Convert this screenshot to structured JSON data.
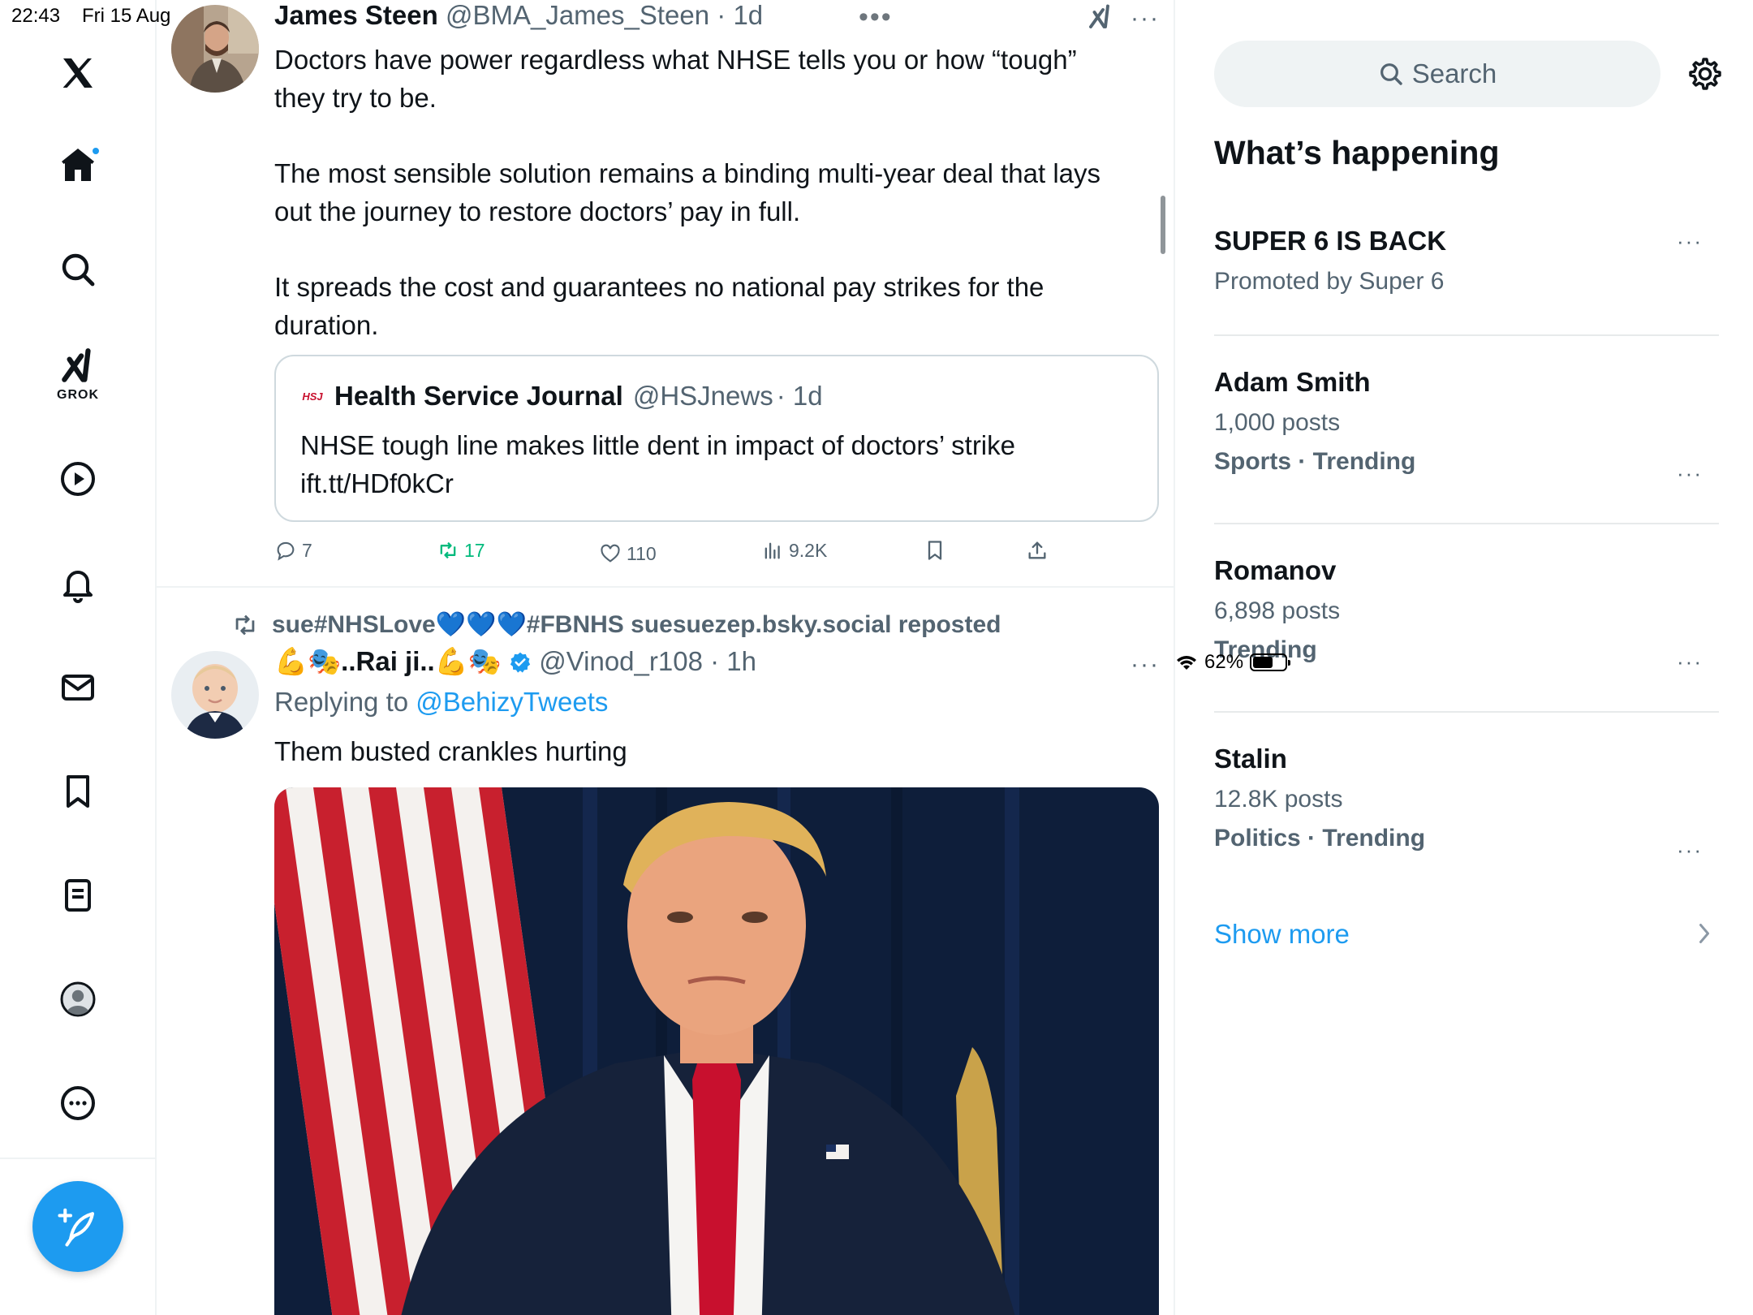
{
  "status": {
    "time": "22:43",
    "date": "Fri 15 Aug",
    "battery": "62%",
    "battery_level": 0.62
  },
  "nav": {
    "grok_label": "GROK",
    "items": [
      "home-icon",
      "search-icon",
      "grok-icon",
      "video-icon",
      "notifications-icon",
      "messages-icon",
      "bookmarks-icon",
      "lists-icon",
      "profile-icon",
      "more-icon"
    ],
    "compose_icon": "compose-icon"
  },
  "tweet1": {
    "name": "James Steen",
    "handle": "@BMA_James_Steen",
    "time": "· 1d",
    "para1": "Doctors have power regardless what NHSE tells you or how “tough” they try to be.",
    "para2": "The most sensible solution remains a binding multi-year deal that lays out the journey to restore doctors’ pay in full.",
    "para3": "It spreads the cost and guarantees no national pay strikes for the duration.",
    "quote": {
      "logo": "HSJ",
      "name": "Health Service Journal",
      "handle": "@HSJnews",
      "time": "· 1d",
      "text": "NHSE tough line makes little dent in impact of doctors’ strike ift.tt/HDf0kCr"
    },
    "actions": {
      "replies": "7",
      "reposts": "17",
      "likes": "110",
      "views": "9.2K"
    }
  },
  "tweet2": {
    "repost_by": "sue#NHSLove💙💙💙#FBNHS suesuezep.bsky.social reposted",
    "name": "💪🎭..Rai ji..💪🎭",
    "handle": "@Vinod_r108",
    "time": "· 1h",
    "replying_label": "Replying to",
    "replying_to": "@BehizyTweets",
    "text": "Them busted crankles hurting"
  },
  "sidebar": {
    "search_placeholder": "Search",
    "title": "What’s happening",
    "trends": [
      {
        "title": "SUPER 6 IS BACK",
        "line2": "Promoted by Super 6",
        "line3": ""
      },
      {
        "title": "Adam Smith",
        "line2": "1,000 posts",
        "line3": "Sports · Trending"
      },
      {
        "title": "Romanov",
        "line2": "6,898 posts",
        "line3": "Trending"
      },
      {
        "title": "Stalin",
        "line2": "12.8K posts",
        "line3": "Politics · Trending"
      }
    ],
    "show_more": "Show more"
  }
}
